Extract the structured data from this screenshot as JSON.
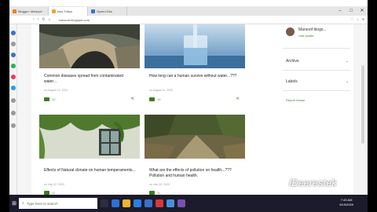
{
  "browser": {
    "tabs": [
      {
        "label": "Blogger: Marsoof",
        "color": "#e8822a",
        "active": false
      },
      {
        "label": "Nou Tritiyo",
        "color": "#f2a33a",
        "active": true
      },
      {
        "label": "Speed Dial",
        "color": "#3b6fcf",
        "active": false
      }
    ],
    "url": "marsoof.blogspot.com",
    "controls": {
      "minimize": "–",
      "maximize": "□",
      "close": "✕"
    }
  },
  "posts": [
    {
      "title": "Common diseases spread from contaminated water...",
      "date": "on August 13, 2020",
      "comments": "10",
      "image": "rock-arch"
    },
    {
      "title": "How long can a human survive without water...???",
      "date": "on August 11, 2020",
      "comments": "10",
      "image": "water-glass"
    },
    {
      "title": "Effects of Natural climate on human temperaments...",
      "date": "on July 22, 2020",
      "comments": "11",
      "image": "vine-window"
    },
    {
      "title": "What are the effects of pollution on health...??? Pollution and human health.",
      "date": "on July 20, 2020",
      "comments": "11",
      "image": "forest-path"
    }
  ],
  "profile": {
    "name": "Marsoof blogs...",
    "link": "Visit profile"
  },
  "widgets": [
    {
      "label": "Archive"
    },
    {
      "label": "Labels"
    }
  ],
  "report_link": "Report Abuse",
  "taskbar": {
    "search_placeholder": "Type here to search",
    "time": "7:43 AM",
    "date": "9/19/2020"
  },
  "watermark": "iDeerestek",
  "colors": {
    "accent": "#3b7d1a",
    "link": "#4a8a2a"
  }
}
